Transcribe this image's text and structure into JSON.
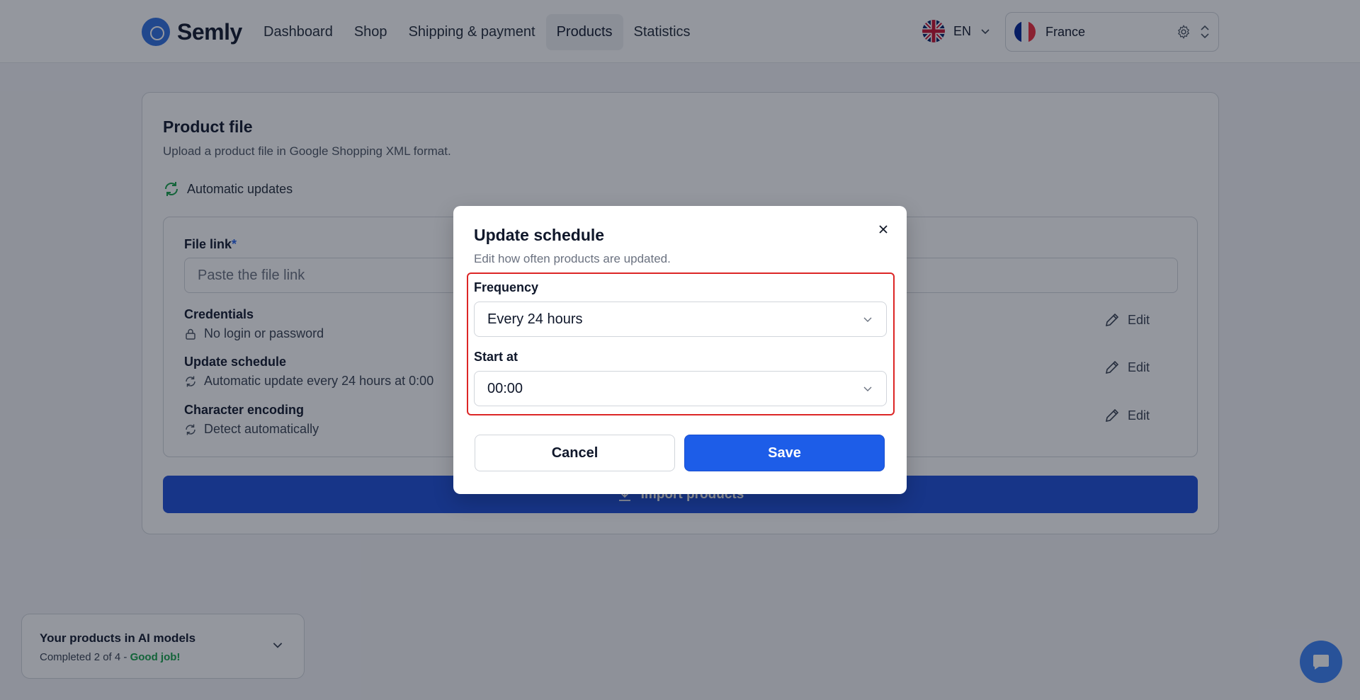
{
  "header": {
    "brand": "Semly",
    "nav": [
      {
        "label": "Dashboard"
      },
      {
        "label": "Shop"
      },
      {
        "label": "Shipping & payment"
      },
      {
        "label": "Products"
      },
      {
        "label": "Statistics"
      }
    ],
    "active_nav": "Products",
    "language": "EN",
    "country": "France"
  },
  "card": {
    "title": "Product file",
    "subtitle": "Upload a product file in Google Shopping XML format.",
    "automatic_updates": "Automatic updates",
    "file_link_label": "File link",
    "file_link_required": "*",
    "file_link_placeholder": "Paste the file link",
    "rows": [
      {
        "title": "Credentials",
        "desc": "No login or password",
        "edit": "Edit"
      },
      {
        "title": "Update schedule",
        "desc": "Automatic update every 24 hours at 0:00",
        "edit": "Edit"
      },
      {
        "title": "Character encoding",
        "desc": "Detect automatically",
        "edit": "Edit"
      }
    ],
    "import_button": "Import products"
  },
  "progress_widget": {
    "title": "Your products in AI models",
    "status": "Completed 2 of 4 -",
    "good": "Good job!"
  },
  "modal": {
    "title": "Update schedule",
    "subtitle": "Edit how often products are updated.",
    "frequency_label": "Frequency",
    "frequency_value": "Every 24 hours",
    "start_label": "Start at",
    "start_value": "00:00",
    "cancel": "Cancel",
    "save": "Save"
  },
  "colors": {
    "accent": "#1d5de8",
    "highlight": "#dc2626",
    "success": "#16a34a"
  }
}
